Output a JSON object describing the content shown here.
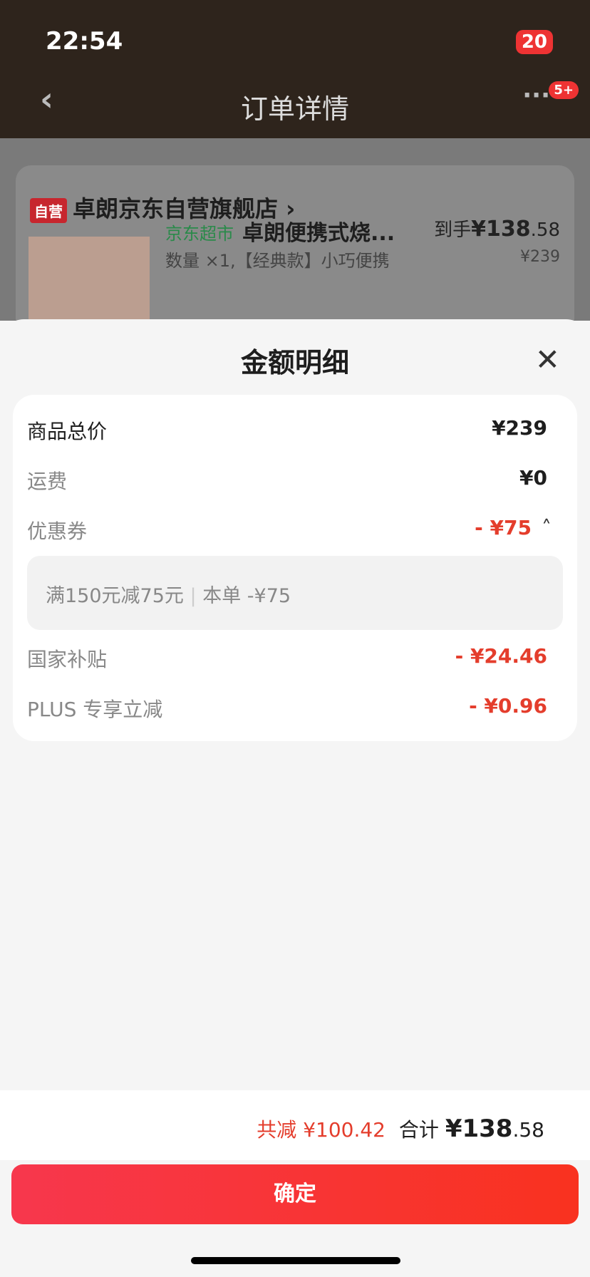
{
  "status": {
    "time": "22:54",
    "battery": "20"
  },
  "nav": {
    "title": "订单详情",
    "badge": "5+"
  },
  "order": {
    "tag": "自营",
    "shop": "卓朗京东自营旗舰店",
    "market": "京东超市",
    "product": "卓朗便携式烧...",
    "price_label": "到手",
    "price_main": "¥138",
    "price_dec": ".58",
    "qty": "数量 ×1,【经典款】小巧便携",
    "orig_price": "¥239"
  },
  "sheet": {
    "title": "金额明细",
    "rows": [
      {
        "label": "商品总价",
        "value": "¥239"
      },
      {
        "label": "运费",
        "value": "¥0"
      },
      {
        "label": "优惠券",
        "value": "- ¥75"
      },
      {
        "label": "国家补贴",
        "value": "- ¥24.46"
      },
      {
        "label": "PLUS 专享立减",
        "value": "- ¥0.96"
      }
    ],
    "coupon": {
      "rule": "满150元减75元",
      "applied": "本单 -¥75"
    }
  },
  "footer": {
    "saved": "共减 ¥100.42",
    "total_label": "合计",
    "total_main": "¥138",
    "total_dec": ".58",
    "confirm": "确定"
  },
  "colors": {
    "accent": "#e43d2c"
  }
}
